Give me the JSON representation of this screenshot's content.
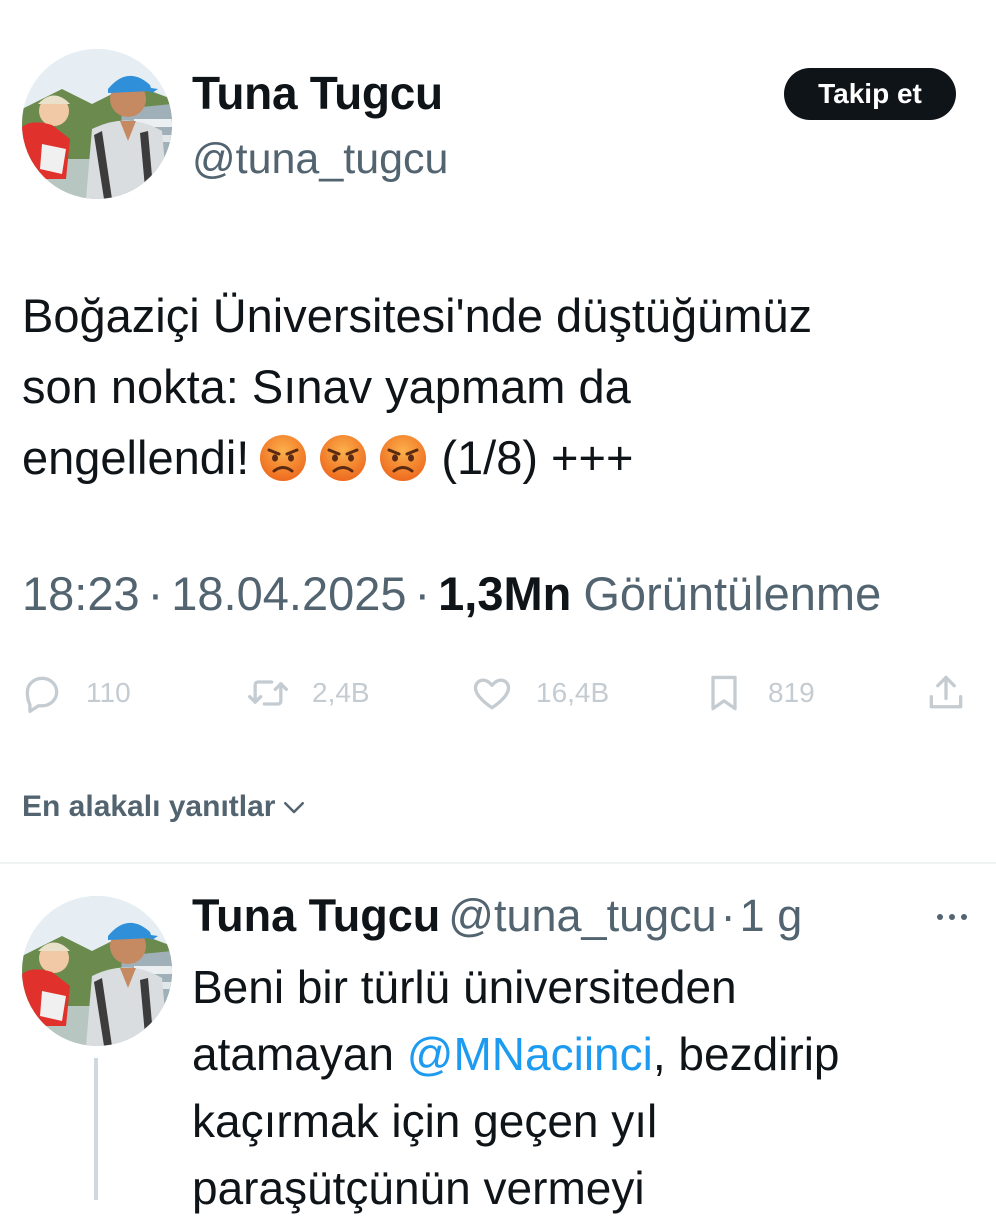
{
  "tweet": {
    "author_name": "Tuna Tugcu",
    "author_handle": "@tuna_tugcu",
    "follow_label": "Takip et",
    "text_line1": "Boğaziçi Üniversitesi'nde düştüğümüz",
    "text_line2": "son nokta: Sınav yapmam da",
    "text_line3_start": "engellendi!",
    "text_line3_end": "(1/8) +++",
    "emojis": [
      "angry-face",
      "angry-face",
      "angry-face"
    ],
    "time": "18:23",
    "date": "18.04.2025",
    "separator": "·",
    "views_count": "1,3Mn",
    "views_label": "Görüntülenme"
  },
  "actions": {
    "replies": "110",
    "reposts": "2,4B",
    "likes": "16,4B",
    "bookmarks": "819"
  },
  "replies_section": {
    "sort_label": "En alakalı yanıtlar"
  },
  "reply": {
    "author_name": "Tuna Tugcu",
    "author_handle": "@tuna_tugcu",
    "separator": "·",
    "time": "1 g",
    "line1": "Beni bir türlü üniversiteden",
    "line2_start": "atamayan",
    "mention": "@MNaciinci",
    "line2_end": ", bezdirip",
    "line3": "kaçırmak için geçen yıl",
    "line4": "paraşütçünün vermeyi"
  },
  "colors": {
    "text": "#0f1419",
    "secondary": "#536471",
    "link": "#1d9bf0",
    "action_icons": "#c4ccd2",
    "emoji": "#f4812b"
  }
}
